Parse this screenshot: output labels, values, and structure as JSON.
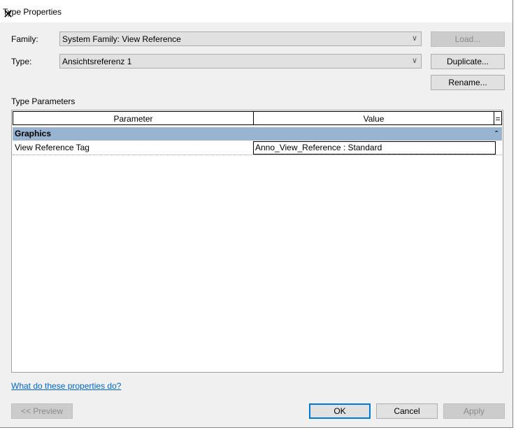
{
  "title": "Type Properties",
  "family": {
    "label": "Family:",
    "value": "System Family: View Reference"
  },
  "type": {
    "label": "Type:",
    "value": "Ansichtsreferenz 1"
  },
  "buttons": {
    "load": "Load...",
    "duplicate": "Duplicate...",
    "rename": "Rename...",
    "preview": "<< Preview",
    "ok": "OK",
    "cancel": "Cancel",
    "apply": "Apply"
  },
  "section_label": "Type Parameters",
  "table": {
    "headers": [
      "Parameter",
      "Value",
      "="
    ],
    "group": {
      "name": "Graphics",
      "toggle": "ˆ"
    },
    "rows": [
      {
        "parameter": "View Reference Tag",
        "value": "Anno_View_Reference : Standard"
      }
    ]
  },
  "help_link": "What do these properties do?",
  "close": "✕"
}
